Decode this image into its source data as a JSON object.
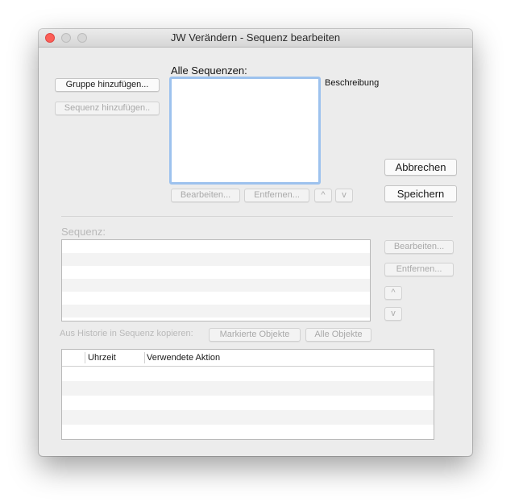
{
  "window": {
    "title": "JW Verändern - Sequenz bearbeiten"
  },
  "top": {
    "add_group_button": "Gruppe hinzufügen...",
    "add_sequence_button": "Sequenz hinzufügen..",
    "all_sequences_label": "Alle Sequenzen:",
    "description_label": "Beschreibung",
    "edit_button": "Bearbeiten...",
    "remove_button": "Entfernen...",
    "up_button": "^",
    "down_button": "v",
    "cancel_button": "Abbrechen",
    "save_button": "Speichern"
  },
  "sequence": {
    "label": "Sequenz:",
    "edit_button": "Bearbeiten...",
    "remove_button": "Entfernen...",
    "up_button": "^",
    "down_button": "v"
  },
  "history": {
    "copy_label": "Aus Historie in Sequenz kopieren:",
    "marked_button": "Markierte Objekte",
    "all_button": "Alle Objekte",
    "columns": [
      "",
      "Uhrzeit",
      "Verwendete Aktion"
    ]
  },
  "colors": {
    "close": "#fc5f57",
    "focus_ring": "#9dc2ee",
    "window_bg": "#ececec"
  }
}
